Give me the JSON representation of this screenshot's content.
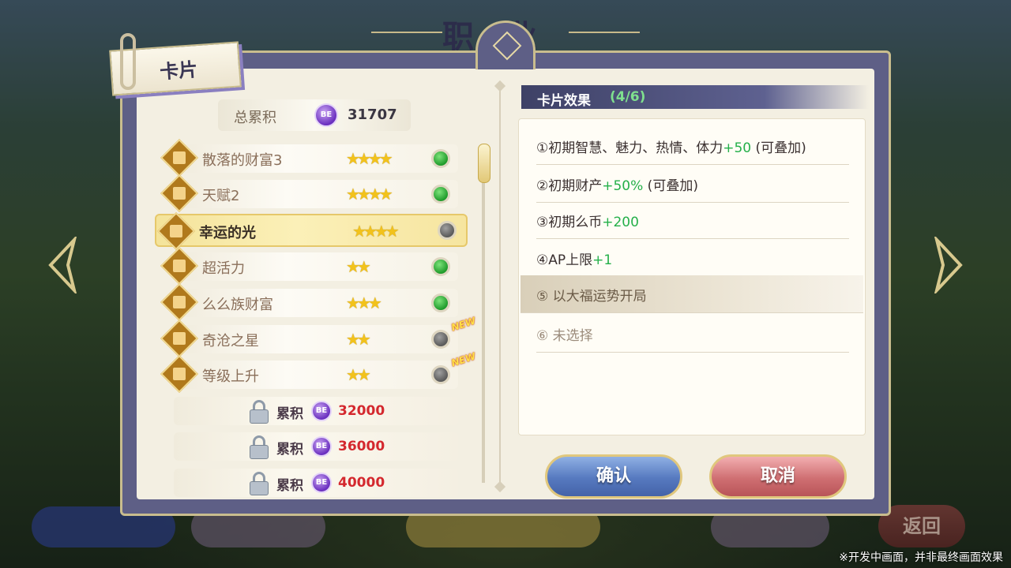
{
  "screen": {
    "bg_title": "职业选择",
    "back_label": "返回",
    "disclaimer": "※开发中画面，并非最终画面效果"
  },
  "dialog": {
    "tab_label": "卡片",
    "total": {
      "label": "总累积",
      "currency_icon": "BE",
      "value": "31707"
    },
    "cards": [
      {
        "name": "散落的财富3",
        "stars": "★★★★",
        "status": "on",
        "is_new": false,
        "selected": false
      },
      {
        "name": "天赋2",
        "stars": "★★★★",
        "status": "on",
        "is_new": false,
        "selected": false
      },
      {
        "name": "幸运的光",
        "stars": "★★★★",
        "status": "off",
        "is_new": false,
        "selected": true
      },
      {
        "name": "超活力",
        "stars": "★★",
        "status": "on",
        "is_new": false,
        "selected": false
      },
      {
        "name": "么么族财富",
        "stars": "★★★",
        "status": "on",
        "is_new": false,
        "selected": false
      },
      {
        "name": "奇沧之星",
        "stars": "★★",
        "status": "off",
        "is_new": true,
        "selected": false
      },
      {
        "name": "等级上升",
        "stars": "★★",
        "status": "off",
        "is_new": true,
        "selected": false
      }
    ],
    "new_badge": "NEW",
    "locked": [
      {
        "label": "累积",
        "value": "32000"
      },
      {
        "label": "累积",
        "value": "36000"
      },
      {
        "label": "累积",
        "value": "40000"
      }
    ],
    "effects": {
      "title": "卡片效果",
      "count": "(4/6)",
      "items": [
        {
          "prefix": "①初期智慧、魅力、热情、体力",
          "plus": "+50",
          "suffix": " (可叠加)"
        },
        {
          "prefix": "②初期财产",
          "plus": "+50%",
          "suffix": " (可叠加)"
        },
        {
          "prefix": "③初期么币",
          "plus": "+200",
          "suffix": ""
        },
        {
          "prefix": "④AP上限",
          "plus": "+1",
          "suffix": ""
        },
        {
          "prefix": "⑤ 以大福运势开局",
          "plus": "",
          "suffix": ""
        },
        {
          "prefix": "⑥ 未选择",
          "plus": "",
          "suffix": ""
        }
      ]
    },
    "confirm_label": "确认",
    "cancel_label": "取消",
    "colors": {
      "accent_green": "#25b04a",
      "locked_red": "#d4282e",
      "star": "#f2c21c",
      "panel": "#5e5f86"
    }
  }
}
